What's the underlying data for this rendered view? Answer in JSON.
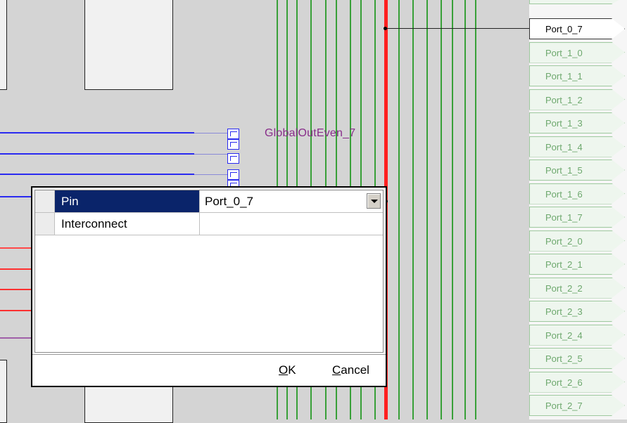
{
  "schematic": {
    "net_label": "GlobalOutEven_7",
    "colors": {
      "background": "#d4d4d4",
      "bus_red": "#ff2020",
      "wire_green": "#38a038",
      "wire_blue": "#2a2af0",
      "label_purple": "#882d8a"
    }
  },
  "ports": [
    {
      "label": "Port_0_7",
      "active": true
    },
    {
      "label": "Port_1_0"
    },
    {
      "label": "Port_1_1"
    },
    {
      "label": "Port_1_2"
    },
    {
      "label": "Port_1_3"
    },
    {
      "label": "Port_1_4"
    },
    {
      "label": "Port_1_5"
    },
    {
      "label": "Port_1_6"
    },
    {
      "label": "Port_1_7"
    },
    {
      "label": "Port_2_0"
    },
    {
      "label": "Port_2_1"
    },
    {
      "label": "Port_2_2"
    },
    {
      "label": "Port_2_3"
    },
    {
      "label": "Port_2_4"
    },
    {
      "label": "Port_2_5"
    },
    {
      "label": "Port_2_6"
    },
    {
      "label": "Port_2_7"
    }
  ],
  "dialog": {
    "rows": [
      {
        "name": "Pin",
        "value": "Port_0_7",
        "selected": true
      },
      {
        "name": "Interconnect",
        "value": ""
      }
    ],
    "ok_label_accel": "O",
    "ok_label_rest": "K",
    "cancel_label_accel": "C",
    "cancel_label_rest": "ancel"
  }
}
